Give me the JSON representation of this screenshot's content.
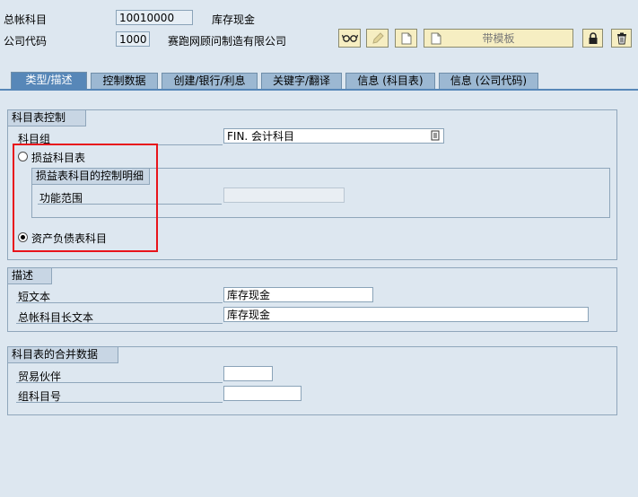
{
  "header": {
    "gl_account_label": "总帐科目",
    "gl_account_value": "10010000",
    "gl_account_desc": "库存现金",
    "company_code_label": "公司代码",
    "company_code_value": "1000",
    "company_name": "赛跑网顾问制造有限公司"
  },
  "toolbar": {
    "template_label": "带模板",
    "icons": [
      "glasses-icon",
      "pencil-icon",
      "new-page-icon",
      "new-page-icon",
      "lock-icon",
      "trash-icon"
    ]
  },
  "tabs": [
    {
      "label": "类型/描述",
      "active": true
    },
    {
      "label": "控制数据",
      "active": false
    },
    {
      "label": "创建/银行/利息",
      "active": false
    },
    {
      "label": "关键字/翻译",
      "active": false
    },
    {
      "label": "信息 (科目表)",
      "active": false
    },
    {
      "label": "信息 (公司代码)",
      "active": false
    }
  ],
  "coa_control": {
    "title": "科目表控制",
    "account_group_label": "科目组",
    "account_group_value": "FIN. 会计科目",
    "pl_account_label": "损益科目表",
    "pl_subgroup_title": "损益表科目的控制明细",
    "functional_area_label": "功能范围",
    "functional_area_value": "",
    "bs_account_label": "资产负债表科目",
    "selected": "bs"
  },
  "description": {
    "title": "描述",
    "short_text_label": "短文本",
    "short_text_value": "库存现金",
    "long_text_label": "总帐科目长文本",
    "long_text_value": "库存现金"
  },
  "consolidation": {
    "title": "科目表的合并数据",
    "trading_partner_label": "贸易伙伴",
    "trading_partner_value": "",
    "group_account_label": "组科目号",
    "group_account_value": ""
  },
  "colors": {
    "background": "#dde7f0",
    "tab_active": "#5787b8",
    "highlight_box": "#e8141b"
  }
}
